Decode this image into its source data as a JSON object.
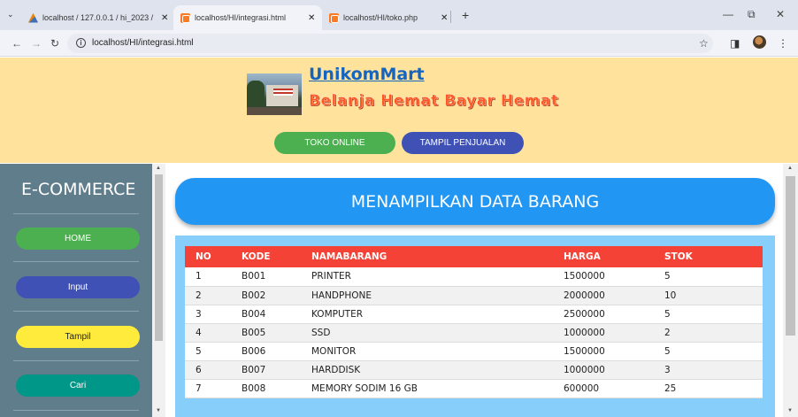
{
  "browser": {
    "tabs": [
      {
        "title": "localhost / 127.0.0.1 / hi_2023 /",
        "active": false
      },
      {
        "title": "localhost/HI/integrasi.html",
        "active": true
      },
      {
        "title": "localhost/HI/toko.php",
        "active": false
      }
    ],
    "url": "localhost/HI/integrasi.html"
  },
  "header": {
    "brand": "UnikomMart",
    "tagline": "Belanja Hemat Bayar Hemat",
    "buttons": {
      "toko": "TOKO ONLINE",
      "tampil": "TAMPIL PENJUALAN"
    }
  },
  "sidebar": {
    "title": "E-COMMERCE",
    "items": [
      {
        "label": "HOME",
        "color": "#4caf50"
      },
      {
        "label": "Input",
        "color": "#3f51b5"
      },
      {
        "label": "Tampil",
        "color": "#ffeb3b"
      },
      {
        "label": "Cari",
        "color": "#009688"
      }
    ]
  },
  "main": {
    "banner": "MENAMPILKAN DATA BARANG",
    "table": {
      "headers": [
        "NO",
        "KODE",
        "NAMABARANG",
        "HARGA",
        "STOK"
      ],
      "rows": [
        [
          "1",
          "B001",
          "PRINTER",
          "1500000",
          "5"
        ],
        [
          "2",
          "B002",
          "HANDPHONE",
          "2000000",
          "10"
        ],
        [
          "3",
          "B004",
          "KOMPUTER",
          "2500000",
          "5"
        ],
        [
          "4",
          "B005",
          "SSD",
          "1000000",
          "2"
        ],
        [
          "5",
          "B006",
          "MONITOR",
          "1500000",
          "5"
        ],
        [
          "6",
          "B007",
          "HARDDISK",
          "1000000",
          "3"
        ],
        [
          "7",
          "B008",
          "MEMORY SODIM 16 GB",
          "600000",
          "25"
        ]
      ]
    }
  },
  "colors": {
    "header_bg": "#ffe29c",
    "sidebar_bg": "#607d8b",
    "banner": "#2196f3",
    "table_head": "#f44336",
    "table_frame": "#87cefa"
  }
}
